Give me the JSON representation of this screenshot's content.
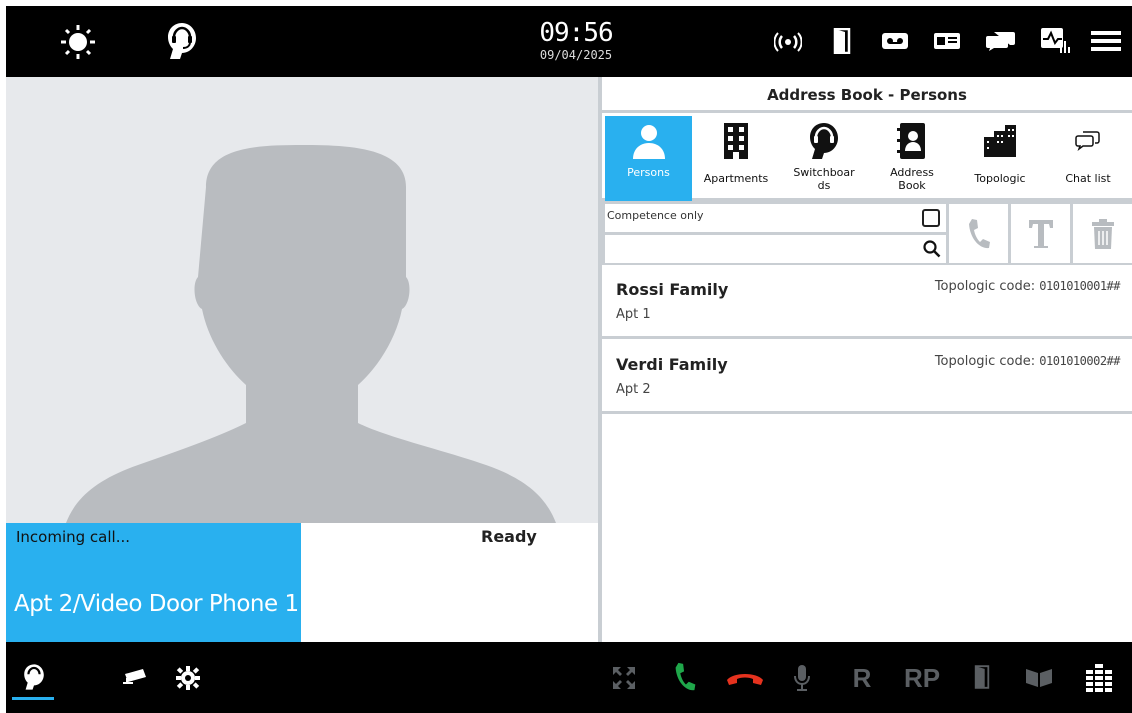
{
  "topbar": {
    "time": "09:56",
    "date": "09/04/2025",
    "icons": [
      "sun-icon",
      "switchboard-headset-icon",
      "signal-icon",
      "door-icon",
      "voicemail-icon",
      "id-card-icon",
      "chat-icon",
      "diagnostics-icon",
      "menu-icon"
    ]
  },
  "call": {
    "status": "Incoming call...",
    "caller": "Apt 2/Video Door Phone 1",
    "ready": "Ready"
  },
  "panel": {
    "title": "Address Book - Persons",
    "tabs": [
      {
        "label": "Persons",
        "icon": "person-icon",
        "active": true
      },
      {
        "label": "Apartments",
        "icon": "building-icon",
        "active": false
      },
      {
        "label": "Switchboards",
        "icon": "switchboard-headset-icon",
        "active": false
      },
      {
        "label": "Address Book",
        "icon": "address-book-icon",
        "active": false
      },
      {
        "label": "Topologic",
        "icon": "topologic-icon",
        "active": false
      },
      {
        "label": "Chat list",
        "icon": "chat-icon",
        "active": false
      }
    ],
    "competence_label": "Competence only",
    "search_placeholder": "",
    "entries": [
      {
        "name": "Rossi Family",
        "apt": "Apt 1",
        "code_label": "Topologic code:",
        "code": "0101010001##"
      },
      {
        "name": "Verdi Family",
        "apt": "Apt 2",
        "code_label": "Topologic code:",
        "code": "0101010002##"
      }
    ]
  },
  "bottombar": {
    "r_label": "R",
    "rp_label": "RP"
  },
  "colors": {
    "accent": "#29b0ef",
    "answer": "#1fa74a",
    "hangup": "#e5321e",
    "disabled": "#5b5f63"
  }
}
